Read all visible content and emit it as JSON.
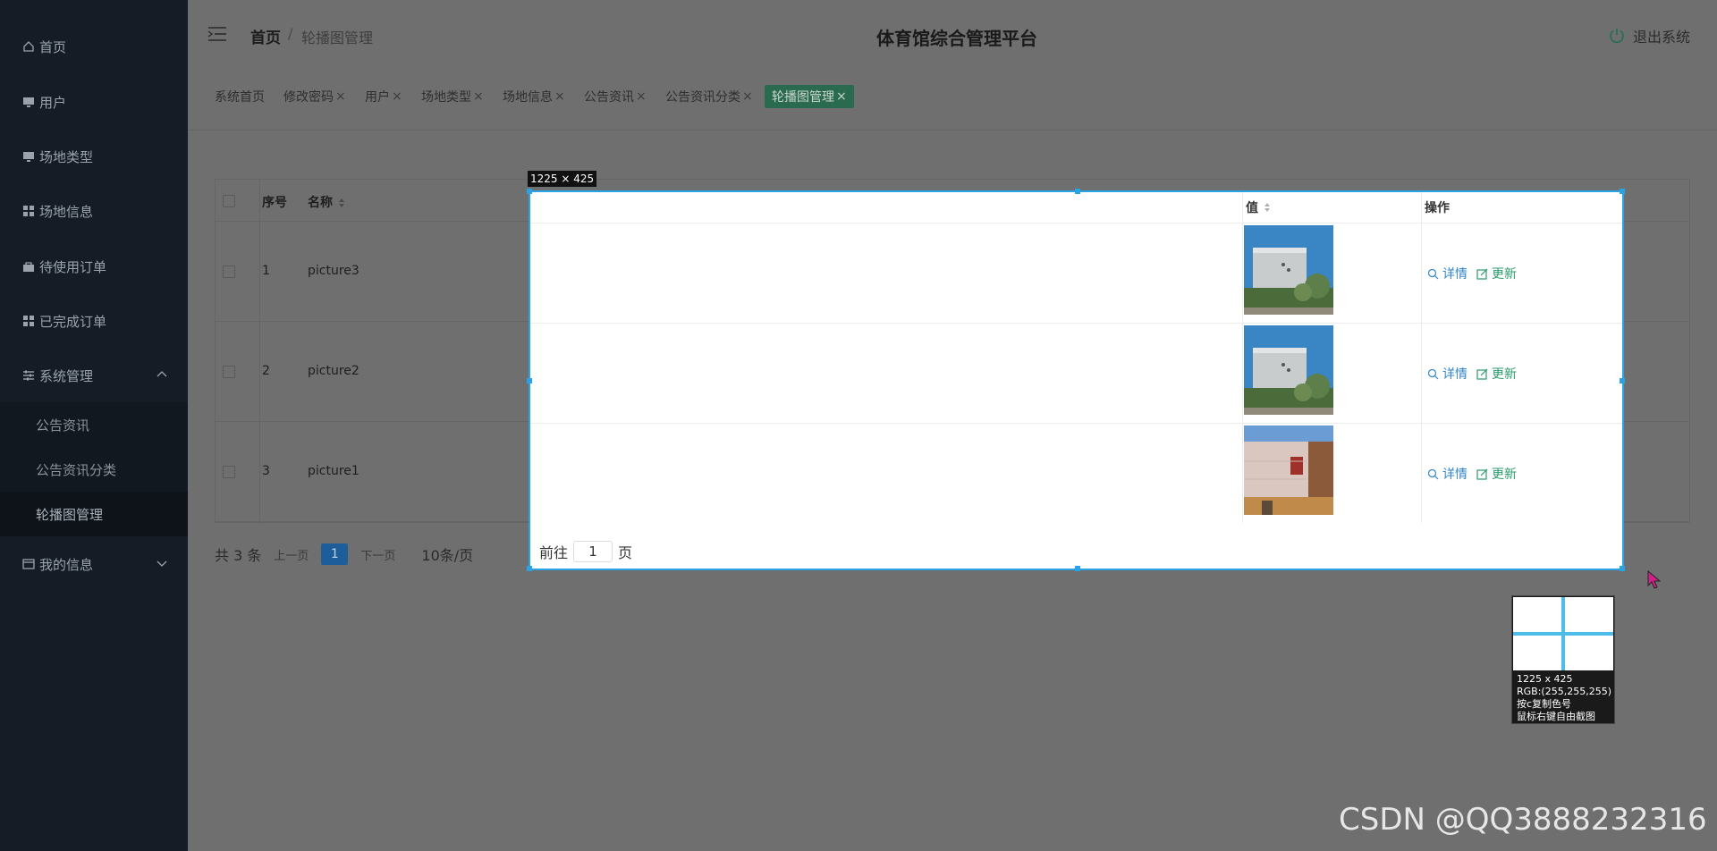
{
  "sidebar": {
    "items": [
      {
        "label": "首页",
        "icon": "home-icon"
      },
      {
        "label": "用户",
        "icon": "monitor-icon"
      },
      {
        "label": "场地类型",
        "icon": "monitor-icon"
      },
      {
        "label": "场地信息",
        "icon": "grid-icon"
      },
      {
        "label": "待使用订单",
        "icon": "bag-icon"
      },
      {
        "label": "已完成订单",
        "icon": "grid-icon"
      },
      {
        "label": "系统管理",
        "icon": "sliders-icon",
        "expanded": true
      },
      {
        "label": "我的信息",
        "icon": "card-icon",
        "expanded": false
      }
    ],
    "submenu": [
      {
        "label": "公告资讯"
      },
      {
        "label": "公告资讯分类"
      },
      {
        "label": "轮播图管理",
        "active": true
      }
    ]
  },
  "header": {
    "breadcrumb_home": "首页",
    "breadcrumb_sep": "/",
    "breadcrumb_current": "轮播图管理",
    "title": "体育馆综合管理平台",
    "logout": "退出系统"
  },
  "tags": [
    {
      "label": "系统首页"
    },
    {
      "label": "修改密码",
      "close": "×"
    },
    {
      "label": "用户",
      "close": "×"
    },
    {
      "label": "场地类型",
      "close": "×"
    },
    {
      "label": "场地信息",
      "close": "×"
    },
    {
      "label": "公告资讯",
      "close": "×"
    },
    {
      "label": "公告资讯分类",
      "close": "×"
    },
    {
      "label": "轮播图管理",
      "close": "×",
      "active": true
    }
  ],
  "table": {
    "headers": {
      "index": "序号",
      "name": "名称",
      "value": "值",
      "actions": "操作"
    },
    "rows": [
      {
        "index": "1",
        "name": "picture3"
      },
      {
        "index": "2",
        "name": "picture2"
      },
      {
        "index": "3",
        "name": "picture1"
      }
    ],
    "detail_label": "详情",
    "update_label": "更新"
  },
  "pagination": {
    "total": "共 3 条",
    "prev": "上一页",
    "current_page": "1",
    "next": "下一页",
    "page_size": "10条/页",
    "goto_prefix": "前往",
    "goto_value": "1",
    "goto_suffix": "页"
  },
  "capture": {
    "size_label": "1225 × 425",
    "info_size": "1225 x 425",
    "info_rgb": "RGB:(255,255,255)",
    "info_copy": "按c复制色号",
    "info_free": "鼠标右键自由截图"
  },
  "watermark": "CSDN @QQ3888232316",
  "colors": {
    "accent_blue": "#2f86c9",
    "accent_green": "#2a9b6c",
    "selection": "#2aa3e6",
    "sidebar_bg": "#151c26"
  }
}
